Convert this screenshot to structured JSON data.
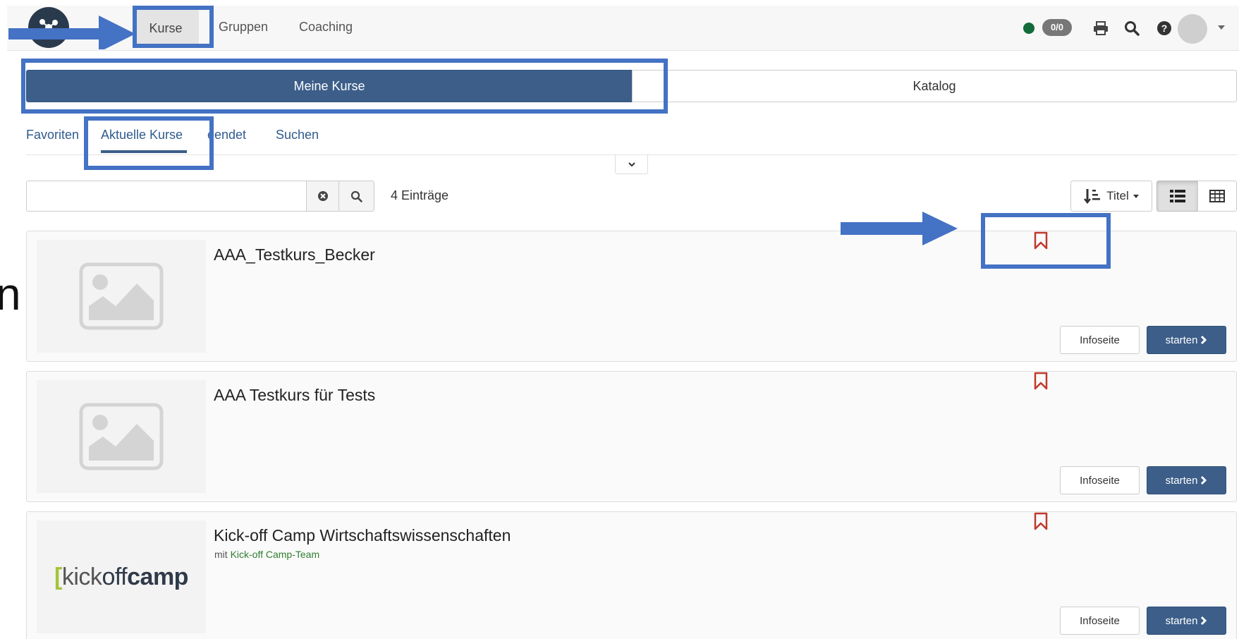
{
  "nav": {
    "items": [
      "Kurse",
      "Gruppen",
      "Coaching"
    ],
    "badge": "0/0"
  },
  "segments": {
    "mine": "Meine Kurse",
    "catalog": "Katalog"
  },
  "tabs": [
    "Favoriten",
    "Aktuelle Kurse",
    "eendet",
    "Suchen"
  ],
  "search": {
    "value": "",
    "placeholder": ""
  },
  "entries_count": "4 Einträge",
  "sort": {
    "label": "Titel"
  },
  "courses": [
    {
      "title": "AAA_Testkurs_Becker",
      "info_label": "Infoseite",
      "start_label": "starten"
    },
    {
      "title": "AAA Testkurs für Tests",
      "info_label": "Infoseite",
      "start_label": "starten"
    },
    {
      "title": "Kick-off Camp Wirtschaftswissenschaften",
      "subtitle_prefix": "mit",
      "subtitle_team": "Kick-off Camp-Team",
      "info_label": "Infoseite",
      "start_label": "starten"
    }
  ],
  "logo_text": {
    "bracket": "[",
    "kick": "kick",
    "off": "off",
    "camp": "camp"
  },
  "edge_text": "n",
  "colors": {
    "primary": "#3c5e89",
    "annotation": "#4472c4",
    "bookmark": "#c0392b",
    "online": "#126b3a",
    "team_link": "#2f7d32"
  }
}
